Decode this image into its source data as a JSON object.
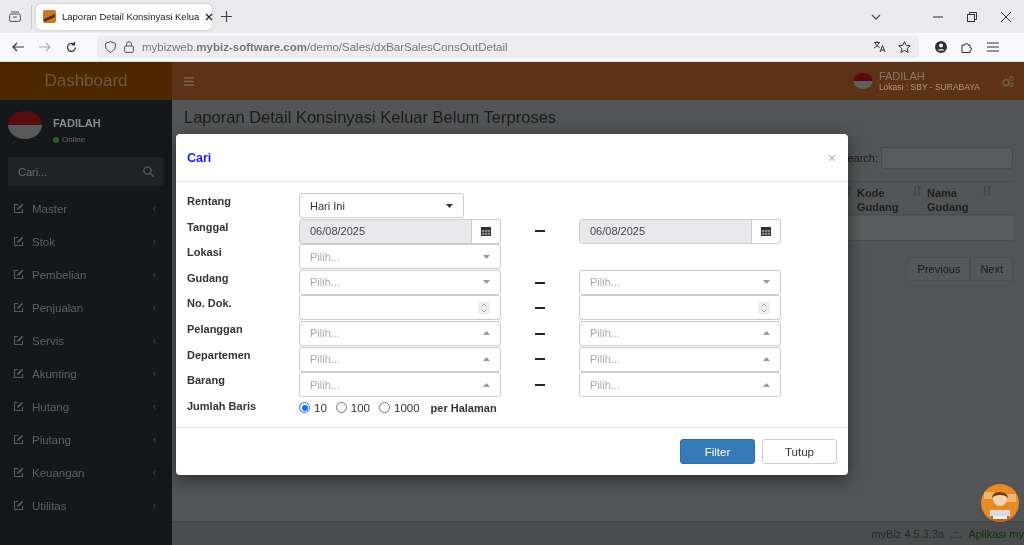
{
  "browser": {
    "tab": {
      "title": "Laporan Detail Konsinyasi Kelua"
    },
    "url": "mybizweb.**mybiz-software.com**/demo/Sales/dxBarSalesConsOutDetail"
  },
  "header": {
    "brand": "Dashboard",
    "user": "FADILAH",
    "location": "Lokasi : SBY - SURABAYA"
  },
  "sidebar": {
    "user": "FADILAH",
    "status": "Online",
    "search": {
      "placeholder": "Cari..."
    },
    "items": [
      {
        "label": "Master"
      },
      {
        "label": "Stok"
      },
      {
        "label": "Pembelian"
      },
      {
        "label": "Penjualan"
      },
      {
        "label": "Servis"
      },
      {
        "label": "Akunting"
      },
      {
        "label": "Hutang"
      },
      {
        "label": "Piutang"
      },
      {
        "label": "Keuangan"
      },
      {
        "label": "Utilitas"
      }
    ]
  },
  "page": {
    "title": "Laporan Detail Konsinyasi Keluar Belum Terproses",
    "search_label": "earch:",
    "columns": [
      "Kode Gudang",
      "Nama Gudang"
    ],
    "pagination": [
      "Previous",
      "Next"
    ]
  },
  "footer": {
    "version": "myBiz 4.5.3.3a",
    "separator": ".::.",
    "app": "Aplikasi my"
  },
  "modal": {
    "title": "Cari",
    "rows": [
      {
        "label": "Rentang",
        "kind": "fields",
        "inputs": [
          {
            "kind": "dropdown",
            "value": "Hari Ini"
          }
        ]
      },
      {
        "label": "Tanggal",
        "kind": "fields",
        "inputs": [
          {
            "kind": "date",
            "value": "06/08/2025"
          },
          {
            "kind": "date",
            "value": "06/08/2025"
          }
        ]
      },
      {
        "label": "Lokasi",
        "kind": "fields",
        "inputs": [
          {
            "kind": "select",
            "placeholder": "Pilih...",
            "open": false
          }
        ]
      },
      {
        "label": "Gudang",
        "kind": "fields",
        "inputs": [
          {
            "kind": "select",
            "placeholder": "Pilih...",
            "open": false
          },
          {
            "kind": "select",
            "placeholder": "Pilih...",
            "open": false
          }
        ]
      },
      {
        "label": "No. Dok.",
        "kind": "fields",
        "inputs": [
          {
            "kind": "number"
          },
          {
            "kind": "number"
          }
        ]
      },
      {
        "label": "Pelanggan",
        "kind": "fields",
        "inputs": [
          {
            "kind": "select",
            "placeholder": "Pilih...",
            "open": true
          },
          {
            "kind": "select",
            "placeholder": "Pilih...",
            "open": true
          }
        ]
      },
      {
        "label": "Departemen",
        "kind": "fields",
        "inputs": [
          {
            "kind": "select",
            "placeholder": "Pilih...",
            "open": true
          },
          {
            "kind": "select",
            "placeholder": "Pilih...",
            "open": true
          }
        ]
      },
      {
        "label": "Barang",
        "kind": "fields",
        "inputs": [
          {
            "kind": "select",
            "placeholder": "Pilih...",
            "open": true
          },
          {
            "kind": "select",
            "placeholder": "Pilih...",
            "open": true
          }
        ]
      },
      {
        "label": "Jumlah Baris",
        "kind": "radio",
        "options": [
          {
            "label": "10",
            "selected": true
          },
          {
            "label": "100",
            "selected": false
          },
          {
            "label": "1000",
            "selected": false
          }
        ],
        "suffix": "per Halaman"
      }
    ],
    "buttons": [
      {
        "label": "Filter",
        "kind": "primary"
      },
      {
        "label": "Tutup",
        "kind": "default"
      }
    ]
  }
}
